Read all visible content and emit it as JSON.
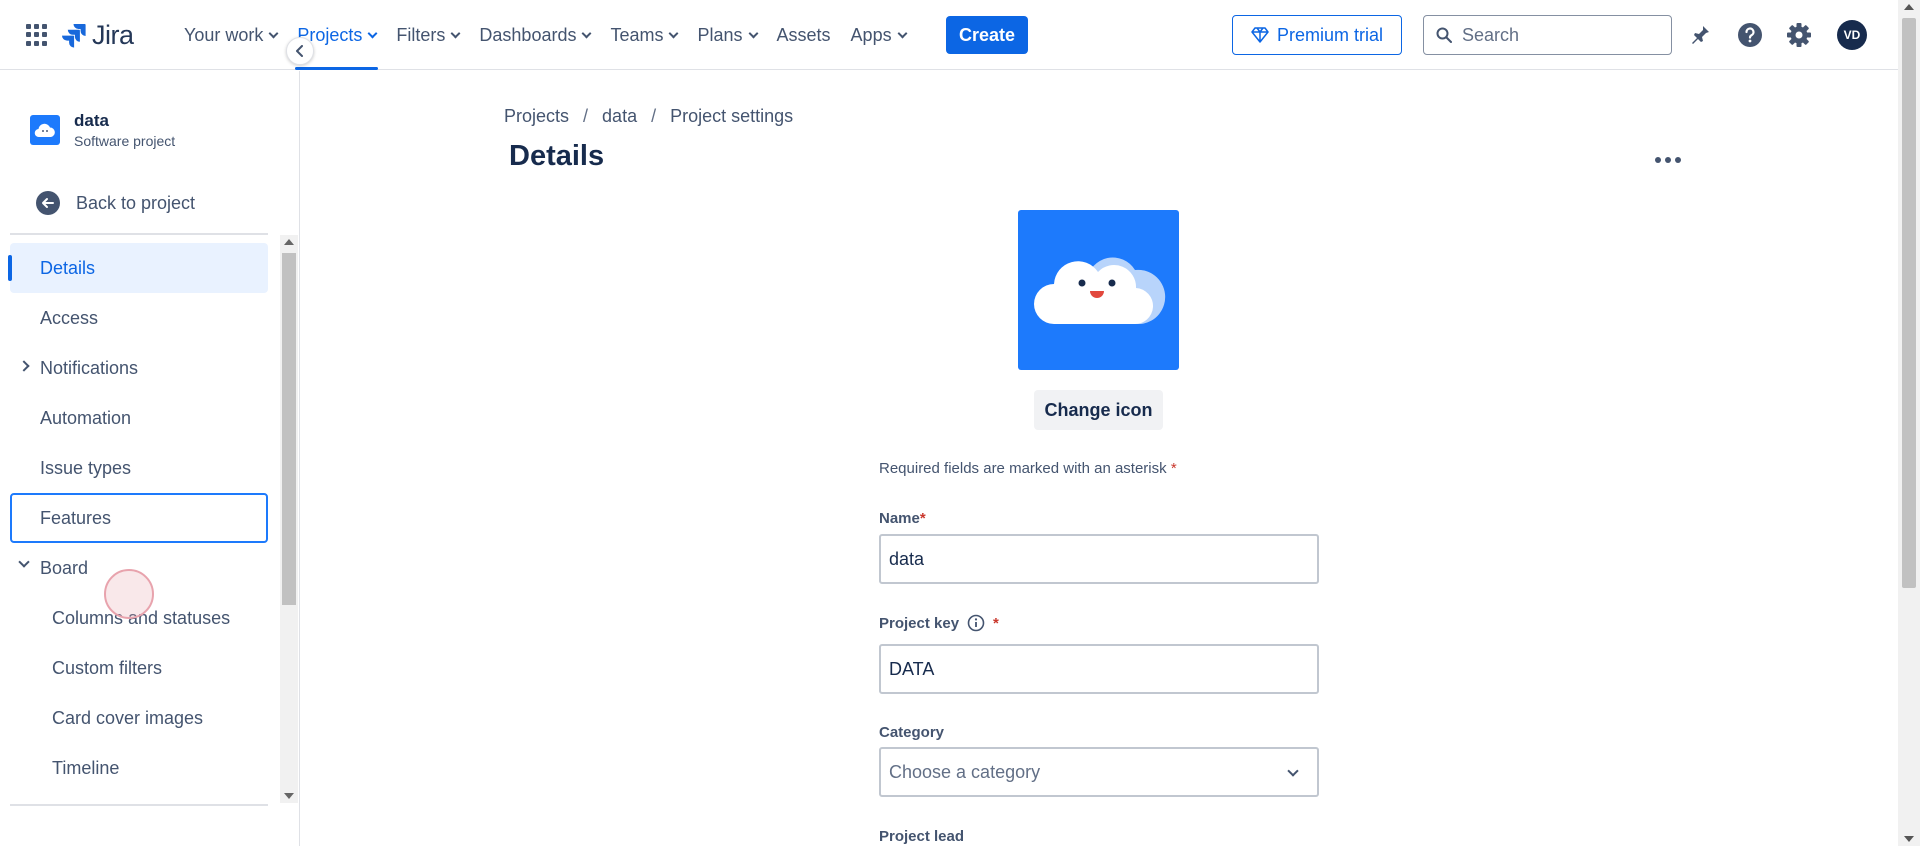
{
  "topnav": {
    "logo_text": "Jira",
    "items": [
      {
        "label": "Your work",
        "chevron": true
      },
      {
        "label": "Projects",
        "chevron": true,
        "active": true
      },
      {
        "label": "Filters",
        "chevron": true
      },
      {
        "label": "Dashboards",
        "chevron": true
      },
      {
        "label": "Teams",
        "chevron": true
      },
      {
        "label": "Plans",
        "chevron": true
      },
      {
        "label": "Assets",
        "chevron": false
      },
      {
        "label": "Apps",
        "chevron": true
      }
    ],
    "create_label": "Create",
    "premium_label": "Premium trial",
    "search_placeholder": "Search",
    "avatar_initials": "VD"
  },
  "sidebar": {
    "project_name": "data",
    "project_type": "Software project",
    "back_label": "Back to project",
    "items": [
      {
        "label": "Details",
        "state": "selected"
      },
      {
        "label": "Access"
      },
      {
        "label": "Notifications",
        "expander": "right"
      },
      {
        "label": "Automation"
      },
      {
        "label": "Issue types"
      },
      {
        "label": "Features",
        "state": "focused"
      },
      {
        "label": "Board",
        "expander": "down"
      },
      {
        "label": "Columns and statuses",
        "sub": true
      },
      {
        "label": "Custom filters",
        "sub": true
      },
      {
        "label": "Card cover images",
        "sub": true
      },
      {
        "label": "Timeline",
        "sub": true
      }
    ]
  },
  "main": {
    "breadcrumb": [
      "Projects",
      "data",
      "Project settings"
    ],
    "breadcrumb_sep": "/",
    "title": "Details",
    "change_icon_label": "Change icon",
    "required_note": "Required fields are marked with an asterisk",
    "required_mark": "*",
    "fields": {
      "name_label": "Name",
      "name_value": "data",
      "key_label": "Project key",
      "key_value": "DATA",
      "category_label": "Category",
      "category_placeholder": "Choose a category",
      "lead_label": "Project lead"
    }
  },
  "colors": {
    "brand_blue": "#0c66e4",
    "project_icon_bg": "#1d7afc",
    "required": "#c9372c"
  }
}
